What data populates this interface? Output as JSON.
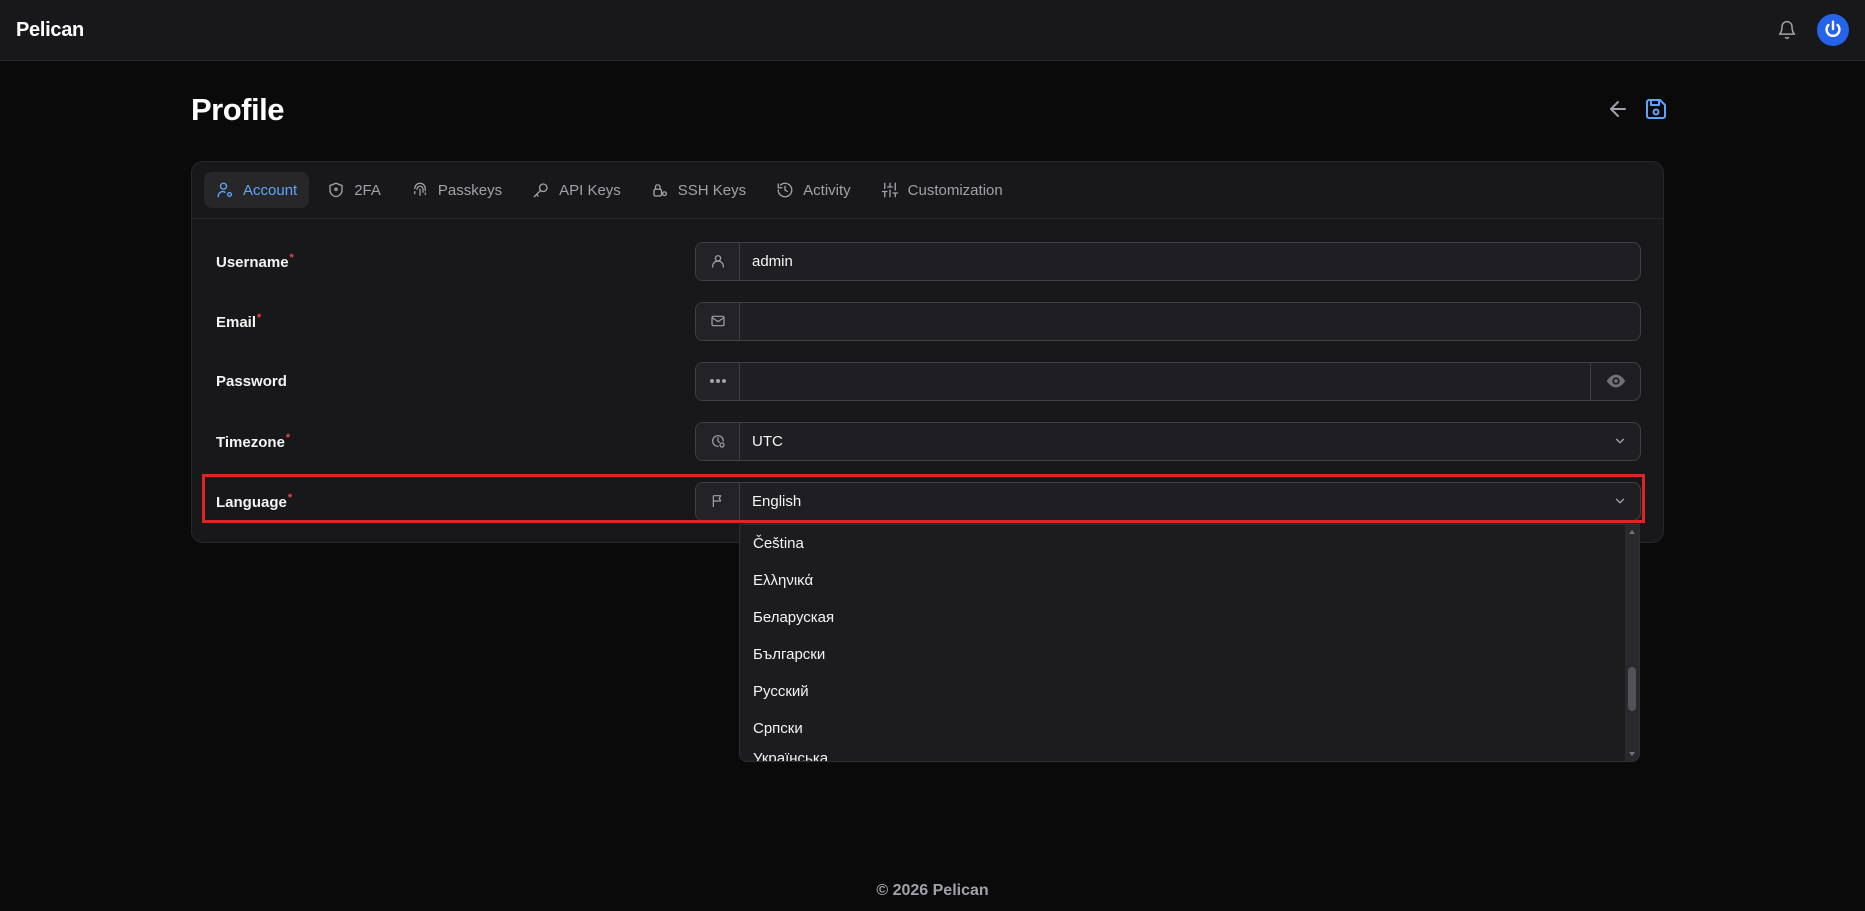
{
  "app": {
    "brand": "Pelican"
  },
  "page": {
    "title": "Profile"
  },
  "tabs": [
    {
      "label": "Account",
      "icon": "user-gear-icon",
      "active": true
    },
    {
      "label": "2FA",
      "icon": "shield-icon"
    },
    {
      "label": "Passkeys",
      "icon": "fingerprint-icon"
    },
    {
      "label": "API Keys",
      "icon": "key-icon"
    },
    {
      "label": "SSH Keys",
      "icon": "lock-key-icon"
    },
    {
      "label": "Activity",
      "icon": "history-icon"
    },
    {
      "label": "Customization",
      "icon": "sliders-icon"
    }
  ],
  "form": {
    "username": {
      "label": "Username",
      "required": "*",
      "value": "admin"
    },
    "email": {
      "label": "Email",
      "required": "*",
      "value": ""
    },
    "password": {
      "label": "Password",
      "value": ""
    },
    "timezone": {
      "label": "Timezone",
      "required": "*",
      "value": "UTC"
    },
    "language": {
      "label": "Language",
      "required": "*",
      "value": "English"
    }
  },
  "language_options": [
    "Čeština",
    "Ελληνικά",
    "Беларуская",
    "Български",
    "Русский",
    "Српски",
    "Українська"
  ],
  "footer": {
    "text": "© 2026 Pelican"
  },
  "colors": {
    "accent": "#60a5fa",
    "brand_avatar": "#2563eb",
    "required": "#ef4444",
    "highlight": "#dc2626"
  }
}
